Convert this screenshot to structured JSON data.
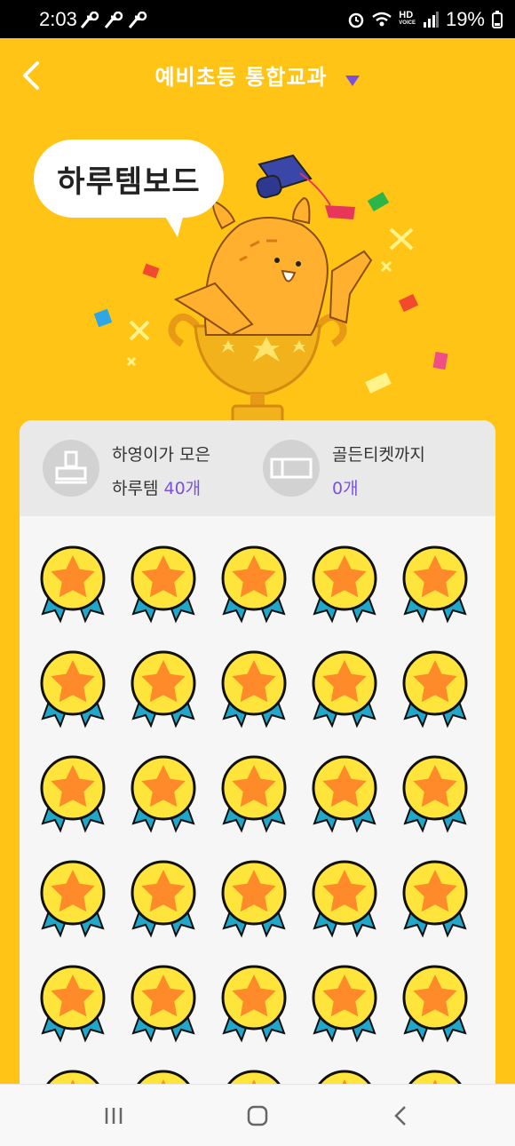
{
  "status_bar": {
    "time": "2:03",
    "left_icons": [
      "missed-call-icon",
      "missed-call-icon",
      "missed-call-icon"
    ],
    "right_icons": [
      "alarm-icon",
      "wifi-icon",
      "hd-voice-icon",
      "signal-icon",
      "battery-icon"
    ],
    "hd_label": "HD",
    "voice_label": "VOICE",
    "battery": "19%"
  },
  "header": {
    "title": "예비초등 통합교과",
    "back_icon": "chevron-left-icon",
    "dropdown_icon": "triangle-down-icon"
  },
  "hero": {
    "bubble_text": "하루템보드"
  },
  "stats": {
    "collected": {
      "line1": "하영이가 모은",
      "line2_prefix": "하루템 ",
      "count": "40개",
      "icon": "stamp-icon"
    },
    "golden": {
      "line1": "골든티켓까지",
      "count": "0개",
      "icon": "ticket-icon"
    }
  },
  "medals": {
    "icon": "star-medal-icon",
    "rows_visible": 5,
    "columns": 5
  },
  "nav_bar": {
    "items": [
      "recent-apps-icon",
      "home-icon",
      "back-icon"
    ]
  },
  "colors": {
    "background": "#FFC416",
    "accent": "#7B4FE0",
    "card": "#F6F6F6"
  }
}
